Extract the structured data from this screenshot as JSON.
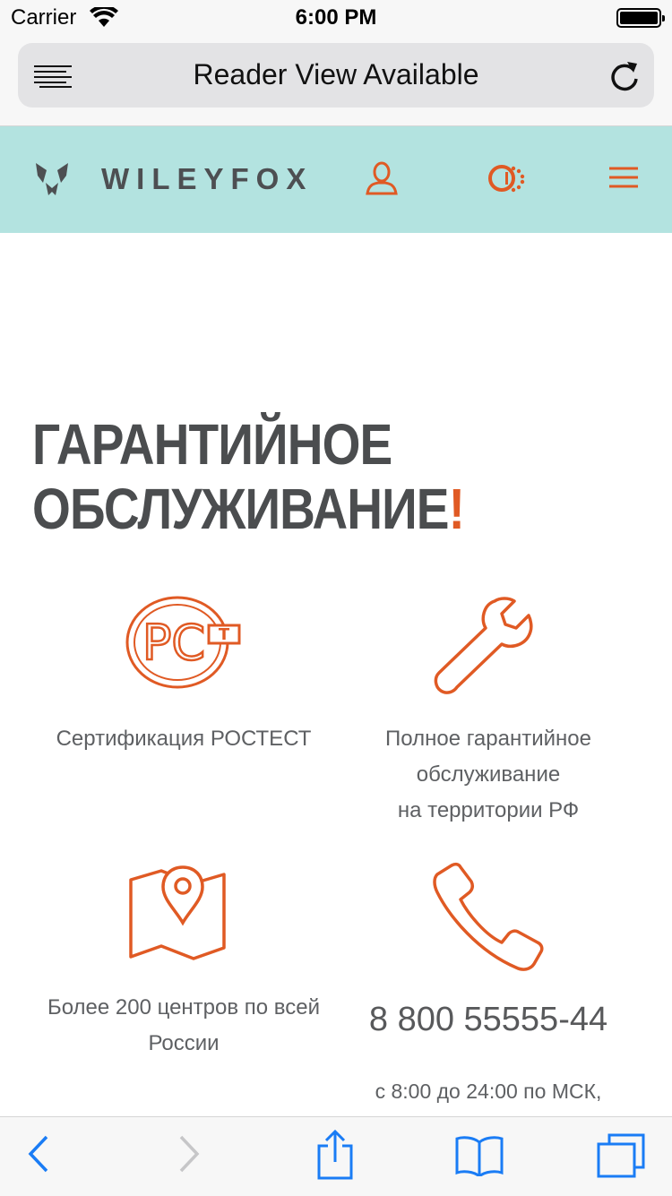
{
  "status_bar": {
    "carrier": "Carrier",
    "time": "6:00 PM"
  },
  "browser": {
    "url_label": "Reader View Available"
  },
  "site": {
    "brand": "WILEYFOX"
  },
  "headline": {
    "line1": "ГАРАНТИЙНОЕ",
    "line2": "ОБСЛУЖИВАНИЕ",
    "mark": "!"
  },
  "features": {
    "rostest": {
      "icon_text": "РСТ",
      "caption": "Сертификация РОСТЕСТ"
    },
    "service": {
      "line1": "Полное гарантийное",
      "line2": "обслуживание",
      "line3": "на территории РФ"
    },
    "centers": {
      "line1": "Более 200 центров по всей",
      "line2": "России"
    },
    "phone": {
      "number": "8 800 55555-44",
      "hours": "с 8:00 до 24:00 по МСК,"
    }
  },
  "colors": {
    "accent": "#e05a24",
    "header_bg": "#b3e3e0",
    "ios_blue": "#1a7cf5"
  }
}
